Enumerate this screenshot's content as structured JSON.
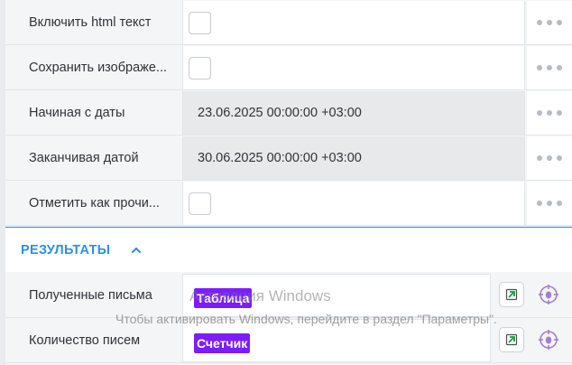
{
  "settings": {
    "rows": [
      {
        "label": "Включить html текст",
        "type": "checkbox"
      },
      {
        "label": "Сохранить изображе...",
        "type": "checkbox"
      },
      {
        "label": "Начиная с даты",
        "type": "date",
        "value": "23.06.2025 00:00:00 +03:00"
      },
      {
        "label": "Заканчивая датой",
        "type": "date",
        "value": "30.06.2025 00:00:00 +03:00"
      },
      {
        "label": "Отметить как прочи...",
        "type": "checkbox"
      }
    ]
  },
  "results": {
    "title": "РЕЗУЛЬТАТЫ",
    "rows": [
      {
        "label": "Полученные письма",
        "tag": "Таблица"
      },
      {
        "label": "Количество писем",
        "tag": "Счетчик"
      }
    ]
  },
  "watermark": {
    "line1": "Активация Windows",
    "line2": "Чтобы активировать Windows, перейдите в раздел \"Параметры\"."
  },
  "colors": {
    "accent": "#2f8fe3",
    "tag": "#7d1dff",
    "date_field_bg": "#e8e9eb"
  },
  "icons": [
    "more-dots-icon",
    "chevron-up-icon",
    "document-icon",
    "target-icon"
  ]
}
